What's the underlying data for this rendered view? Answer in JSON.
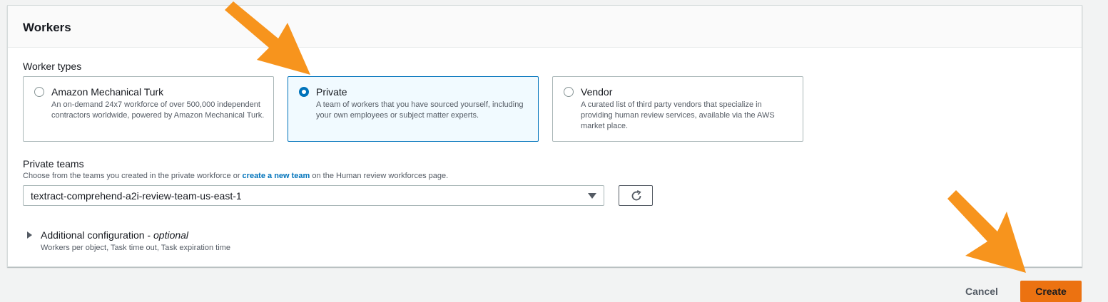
{
  "workers": {
    "title": "Workers",
    "worker_types_label": "Worker types",
    "tiles": [
      {
        "title": "Amazon Mechanical Turk",
        "description": "An on-demand 24x7 workforce of over 500,000 independent contractors worldwide, powered by Amazon Mechanical Turk.",
        "selected": false
      },
      {
        "title": "Private",
        "description": "A team of workers that you have sourced yourself, including your own employees or subject matter experts.",
        "selected": true
      },
      {
        "title": "Vendor",
        "description": "A curated list of third party vendors that specialize in providing human review services, available via the AWS market place.",
        "selected": false
      }
    ],
    "private_teams": {
      "label": "Private teams",
      "help_prefix": "Choose from the teams you created in the private workforce or",
      "help_link": "create a new team",
      "help_suffix": "on the Human review workforces page.",
      "selected_value": "textract-comprehend-a2i-review-team-us-east-1"
    },
    "additional": {
      "title": "Additional configuration -",
      "optional": "optional",
      "description": "Workers per object, Task time out, Task expiration time"
    }
  },
  "footer": {
    "cancel_label": "Cancel",
    "create_label": "Create"
  },
  "colors": {
    "accent": "#0073bb",
    "primary_button": "#ec7211",
    "annotation_arrow": "#f7941d"
  },
  "icons": {
    "refresh": "refresh-icon",
    "dropdown": "caret-down-icon",
    "expand": "caret-right-icon",
    "annotation": "arrow-icon"
  }
}
